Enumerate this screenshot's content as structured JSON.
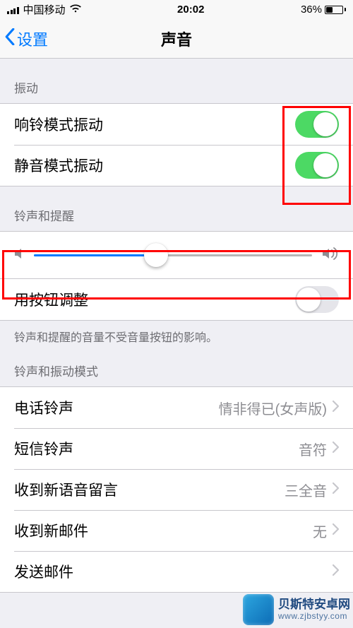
{
  "status": {
    "carrier": "中国移动",
    "time": "20:02",
    "battery_pct": "36%"
  },
  "nav": {
    "back_label": "设置",
    "title": "声音"
  },
  "sections": {
    "vibration_header": "振动",
    "ringer_header": "铃声和提醒",
    "ringer_footer": "铃声和提醒的音量不受音量按钮的影响。",
    "patterns_header": "铃声和振动模式"
  },
  "rows": {
    "vibrate_on_ring": {
      "label": "响铃模式振动",
      "value": true
    },
    "vibrate_on_silent": {
      "label": "静音模式振动",
      "value": true
    },
    "change_with_buttons": {
      "label": "用按钮调整",
      "value": false
    },
    "ringtone": {
      "label": "电话铃声",
      "value": "情非得已(女声版)"
    },
    "text_tone": {
      "label": "短信铃声",
      "value": "音符"
    },
    "new_voicemail": {
      "label": "收到新语音留言",
      "value": "三全音"
    },
    "new_mail": {
      "label": "收到新邮件",
      "value": "无"
    },
    "sent_mail": {
      "label": "发送邮件",
      "value": ""
    }
  },
  "slider": {
    "percent": 44
  },
  "watermark": {
    "line1": "贝斯特安卓网",
    "line2": "www.zjbstyy.com"
  }
}
